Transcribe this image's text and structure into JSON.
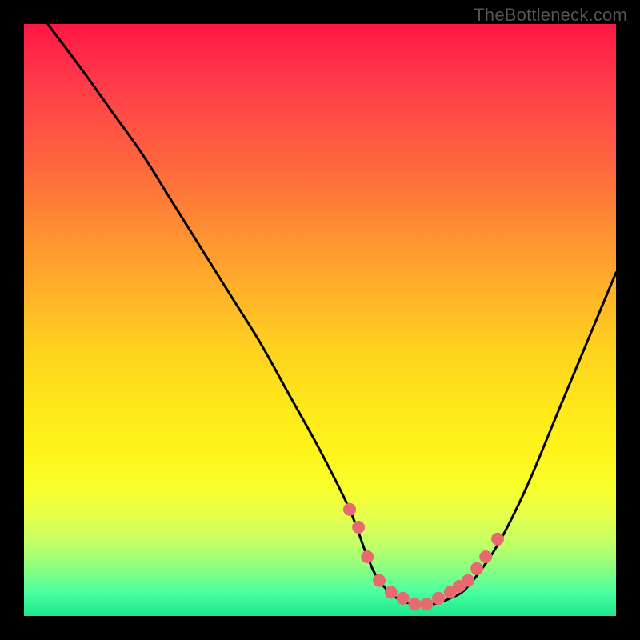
{
  "watermark": "TheBottleneck.com",
  "chart_data": {
    "type": "line",
    "title": "",
    "xlabel": "",
    "ylabel": "",
    "xlim": [
      0,
      100
    ],
    "ylim": [
      0,
      100
    ],
    "series": [
      {
        "name": "bottleneck-curve",
        "x": [
          4,
          10,
          15,
          20,
          25,
          30,
          35,
          40,
          45,
          50,
          55,
          58,
          60,
          63,
          66,
          69,
          72,
          75,
          80,
          85,
          90,
          95,
          100
        ],
        "y": [
          100,
          92,
          85,
          78,
          70,
          62,
          54,
          46,
          37,
          28,
          18,
          10,
          6,
          3,
          2,
          2,
          3,
          5,
          12,
          22,
          34,
          46,
          58
        ]
      }
    ],
    "markers": {
      "name": "highlight-points",
      "color": "#e86a6f",
      "x": [
        55,
        56.5,
        58,
        60,
        62,
        64,
        66,
        68,
        70,
        72,
        73.5,
        75,
        76.5,
        78,
        80
      ],
      "y": [
        18,
        15,
        10,
        6,
        4,
        3,
        2,
        2,
        3,
        4,
        5,
        6,
        8,
        10,
        13
      ]
    }
  }
}
